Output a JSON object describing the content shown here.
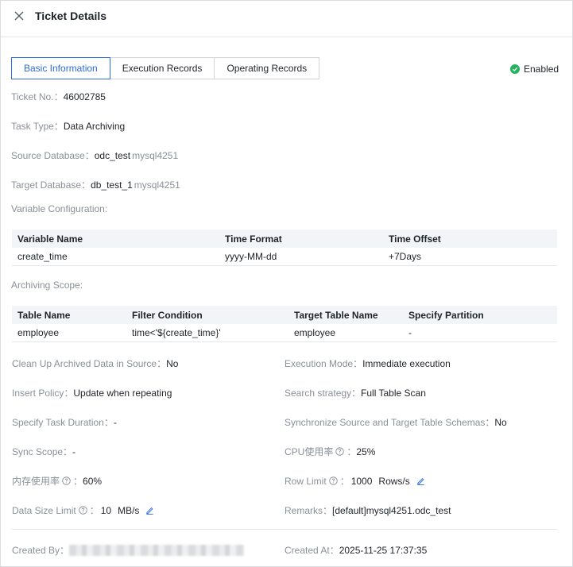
{
  "header": {
    "title": "Ticket Details"
  },
  "tabs": [
    {
      "label": "Basic Information",
      "active": true
    },
    {
      "label": "Execution Records",
      "active": false
    },
    {
      "label": "Operating Records",
      "active": false
    }
  ],
  "status": {
    "label": "Enabled",
    "color": "#22b35e"
  },
  "fields": {
    "ticket_no": {
      "label": "Ticket No.：",
      "value": "46002785"
    },
    "task_type": {
      "label": "Task Type：",
      "value": "Data Archiving"
    },
    "source_db": {
      "label": "Source Database：",
      "value": "odc_test",
      "tag": "mysql4251"
    },
    "target_db": {
      "label": "Target Database：",
      "value": "db_test_1",
      "tag": "mysql4251"
    },
    "variable_config": {
      "label": "Variable Configuration:"
    },
    "archiving_scope": {
      "label": "Archiving Scope:"
    }
  },
  "variable_table": {
    "headers": [
      "Variable Name",
      "Time Format",
      "Time Offset"
    ],
    "rows": [
      [
        "create_time",
        "yyyy-MM-dd",
        "+7Days"
      ]
    ]
  },
  "scope_table": {
    "headers": [
      "Table Name",
      "Filter Condition",
      "Target Table Name",
      "Specify Partition"
    ],
    "rows": [
      [
        "employee",
        "time<'${create_time}'",
        "employee",
        "-"
      ]
    ]
  },
  "details": {
    "cleanup": {
      "label": "Clean Up Archived Data in Source：",
      "value": "No"
    },
    "exec_mode": {
      "label": "Execution Mode：",
      "value": "Immediate execution"
    },
    "insert_policy": {
      "label": "Insert Policy：",
      "value": "Update when repeating"
    },
    "search_strategy": {
      "label": "Search strategy：",
      "value": "Full Table Scan"
    },
    "task_duration": {
      "label": "Specify Task Duration：",
      "value": "-"
    },
    "sync_schemas": {
      "label": "Synchronize Source and Target Table Schemas：",
      "value": "No"
    },
    "sync_scope": {
      "label": "Sync Scope：",
      "value": "-"
    },
    "cpu_usage": {
      "label": "CPU使用率",
      "sep": "：",
      "value": "25%"
    },
    "mem_usage": {
      "label": "内存使用率",
      "sep": "：",
      "value": "60%"
    },
    "row_limit": {
      "label": "Row Limit",
      "sep": "：",
      "value": "1000",
      "unit": "Rows/s"
    },
    "data_size_limit": {
      "label": "Data Size Limit",
      "sep": "：",
      "value": "10",
      "unit": "MB/s"
    },
    "remarks": {
      "label": "Remarks：",
      "value": "[default]mysql4251.odc_test"
    },
    "created_by": {
      "label": "Created By："
    },
    "created_at": {
      "label": "Created At：",
      "value": "2025-11-25 17:37:35"
    }
  },
  "colors": {
    "accent": "#2d6bdc",
    "label": "#8a9099",
    "text": "#1f2329"
  }
}
